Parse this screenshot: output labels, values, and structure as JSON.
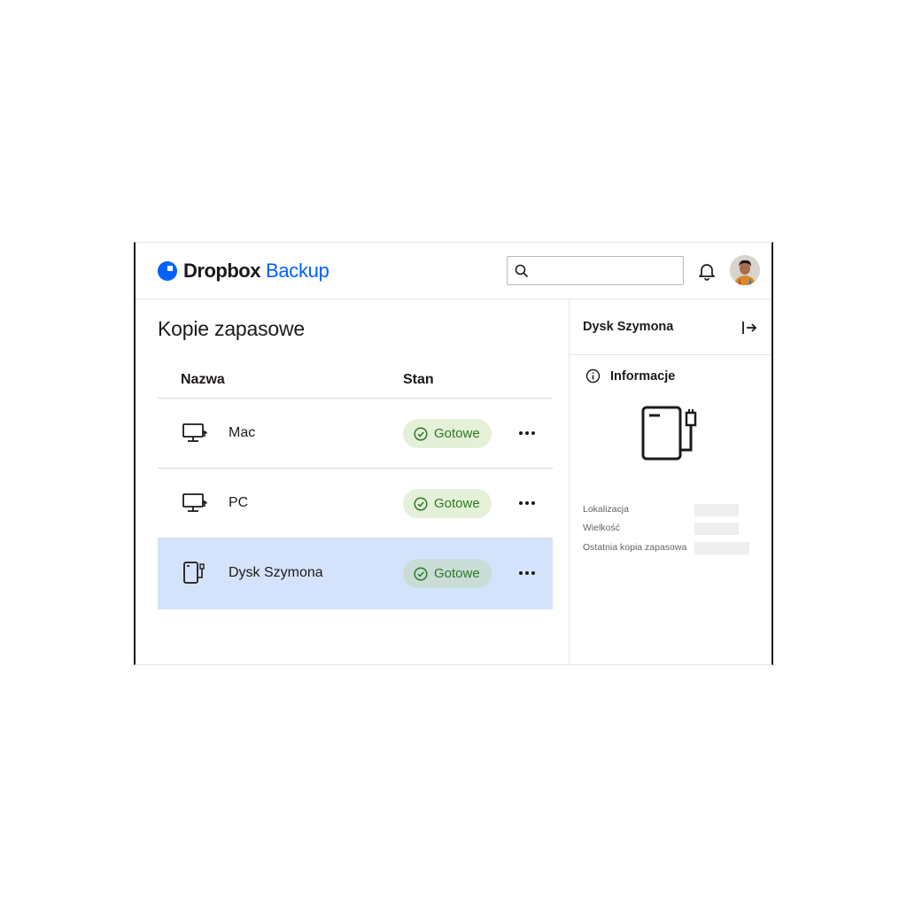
{
  "header": {
    "brand_name": "Dropbox",
    "brand_product": "Backup",
    "brand_color": "#0061fe",
    "search": {
      "placeholder": "",
      "value": ""
    },
    "icons": {
      "search": "search-icon",
      "notifications": "bell-icon",
      "user": "avatar"
    }
  },
  "main": {
    "title": "Kopie zapasowe",
    "columns": {
      "name": "Nazwa",
      "status": "Stan"
    },
    "rows": [
      {
        "icon": "monitor-backup-icon",
        "name": "Mac",
        "status": "Gotowe",
        "selected": false
      },
      {
        "icon": "monitor-backup-icon",
        "name": "PC",
        "status": "Gotowe",
        "selected": false
      },
      {
        "icon": "external-drive-icon",
        "name": "Dysk Szymona",
        "status": "Gotowe",
        "selected": true
      }
    ]
  },
  "panel": {
    "title": "Dysk Szymona",
    "section_label": "Informacje",
    "details": [
      {
        "label": "Lokalizacja",
        "value": ""
      },
      {
        "label": "Wielkość",
        "value": ""
      },
      {
        "label": "Ostatnia kopia zapasowa",
        "value": ""
      }
    ]
  },
  "colors": {
    "status_text": "#2b7a22",
    "status_bg": "#e5f0d8",
    "selected_row_bg": "#d4e3fb"
  }
}
